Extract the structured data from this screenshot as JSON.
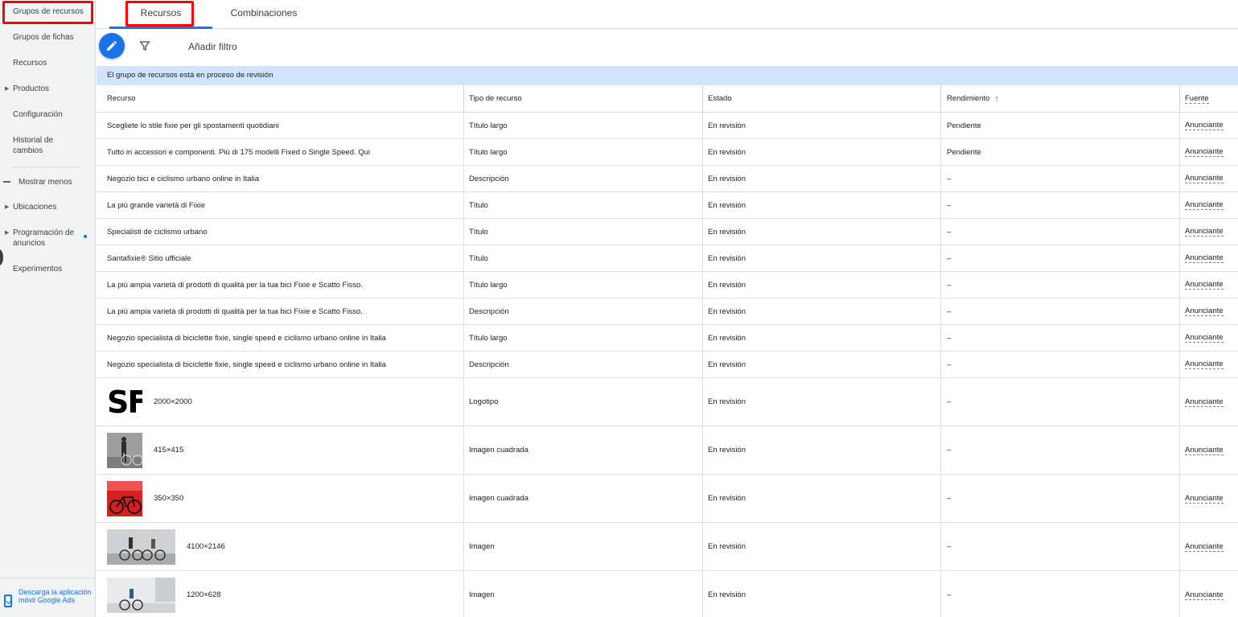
{
  "sidebar": {
    "items": [
      {
        "label": "Grupos de recursos"
      },
      {
        "label": "Grupos de fichas"
      },
      {
        "label": "Recursos"
      },
      {
        "label": "Productos"
      },
      {
        "label": "Configuración"
      },
      {
        "label": "Historial de cambios"
      },
      {
        "label": "Mostrar menos"
      },
      {
        "label": "Ubicaciones"
      },
      {
        "label": "Programación de anuncios"
      },
      {
        "label": "Experimentos"
      }
    ],
    "download_label": "Descarga la aplicación móvil Google Ads"
  },
  "tabs": [
    {
      "label": "Recursos"
    },
    {
      "label": "Combinaciones"
    }
  ],
  "toolbar": {
    "add_filter_label": "Añadir filtro"
  },
  "banner": "El grupo de recursos está en proceso de revisión",
  "table": {
    "headers": [
      "Recurso",
      "Tipo de recurso",
      "Estado",
      "Rendimiento",
      "Fuente"
    ],
    "rows": [
      {
        "recurso": "Scegliete lo stile fixie per gli spostamenti quotidiani",
        "tipo": "Título largo",
        "estado": "En revisión",
        "rendimiento": "Pendiente",
        "fuente": "Anunciante"
      },
      {
        "recurso": "Tutto in accessori e componenti. Più di 175 modelli Fixed o Single Speed. Qui",
        "tipo": "Título largo",
        "estado": "En revisión",
        "rendimiento": "Pendiente",
        "fuente": "Anunciante"
      },
      {
        "recurso": "Negozio bici e ciclismo urbano online in Italia",
        "tipo": "Descripción",
        "estado": "En revisión",
        "rendimiento": "–",
        "fuente": "Anunciante"
      },
      {
        "recurso": "La più grande varietà di Fixie",
        "tipo": "Título",
        "estado": "En revisión",
        "rendimiento": "–",
        "fuente": "Anunciante"
      },
      {
        "recurso": "Specialisti de ciclismo urbano",
        "tipo": "Título",
        "estado": "En revisión",
        "rendimiento": "–",
        "fuente": "Anunciante"
      },
      {
        "recurso": "Santafixie® Sitio ufficiale",
        "tipo": "Título",
        "estado": "En revisión",
        "rendimiento": "–",
        "fuente": "Anunciante"
      },
      {
        "recurso": "La più ampia varietà di prodotti di qualità per la tua bici Fixie e Scatto Fisso.",
        "tipo": "Título largo",
        "estado": "En revisión",
        "rendimiento": "–",
        "fuente": "Anunciante"
      },
      {
        "recurso": "La più ampia varietà di prodotti di qualità per la tua bici Fixie e Scatto Fisso.",
        "tipo": "Descripción",
        "estado": "En revisión",
        "rendimiento": "–",
        "fuente": "Anunciante"
      },
      {
        "recurso": "Negozio specialista di biciclette fixie, single speed e ciclismo urbano online in Italia",
        "tipo": "Título largo",
        "estado": "En revisión",
        "rendimiento": "–",
        "fuente": "Anunciante"
      },
      {
        "recurso": "Negozio specialista di biciclette fixie, single speed e ciclismo urbano online in Italia",
        "tipo": "Descripción",
        "estado": "En revisión",
        "rendimiento": "–",
        "fuente": "Anunciante"
      }
    ],
    "image_rows": [
      {
        "logo_text": "SF",
        "dims": "2000×2000",
        "tipo": "Logotipo",
        "estado": "En revisión",
        "rendimiento": "–",
        "fuente": "Anunciante"
      },
      {
        "dims": "415×415",
        "tipo": "Imagen cuadrada",
        "estado": "En revisión",
        "rendimiento": "–",
        "fuente": "Anunciante"
      },
      {
        "dims": "350×350",
        "tipo": "Imagen cuadrada",
        "estado": "En revisión",
        "rendimiento": "–",
        "fuente": "Anunciante"
      },
      {
        "dims": "4100×2146",
        "tipo": "Imagen",
        "estado": "En revisión",
        "rendimiento": "–",
        "fuente": "Anunciante"
      },
      {
        "dims": "1200×628",
        "tipo": "Imagen",
        "estado": "En revisión",
        "rendimiento": "–",
        "fuente": "Anunciante"
      }
    ]
  },
  "colors": {
    "accent": "#1a73e8",
    "highlight": "#ff0000",
    "banner": "#d2e3fc"
  }
}
